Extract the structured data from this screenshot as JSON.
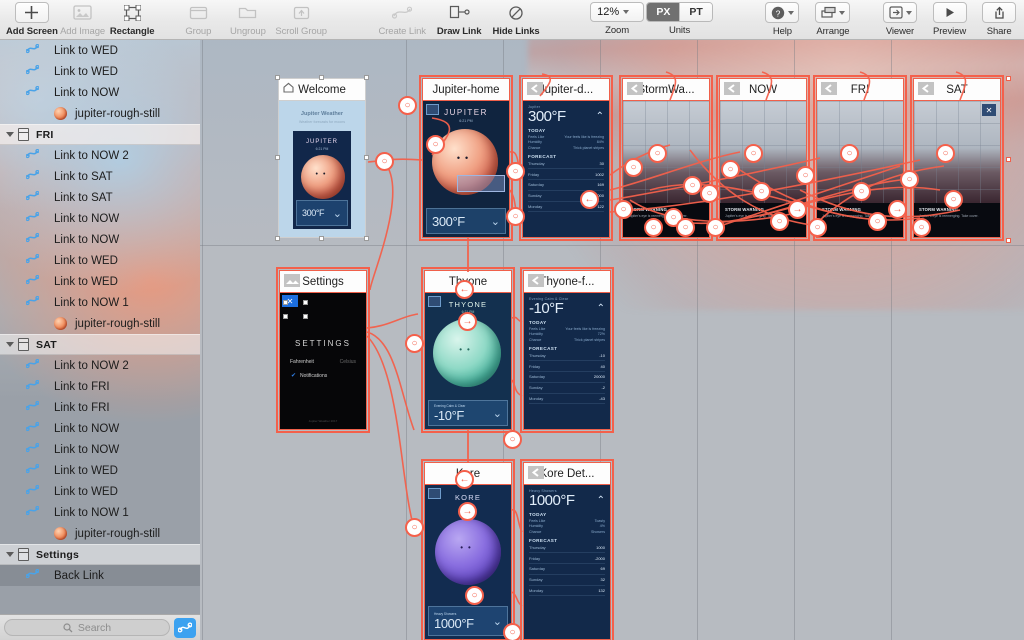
{
  "app": {
    "title": "Prototyping App Canvas"
  },
  "toolbar": {
    "items": [
      {
        "label": "Add Screen",
        "icon": "plus-icon",
        "enabled": true
      },
      {
        "label": "Add Image",
        "icon": "image-icon",
        "enabled": false
      },
      {
        "label": "Rectangle",
        "icon": "rectangle-icon",
        "enabled": true
      },
      {
        "label": "Group",
        "icon": "group-icon",
        "enabled": false
      },
      {
        "label": "Ungroup",
        "icon": "ungroup-icon",
        "enabled": false
      },
      {
        "label": "Scroll Group",
        "icon": "scroll-group-icon",
        "enabled": false
      },
      {
        "label": "Create Link",
        "icon": "create-link-icon",
        "enabled": false
      },
      {
        "label": "Draw Link",
        "icon": "draw-link-icon",
        "enabled": true
      },
      {
        "label": "Hide Links",
        "icon": "hide-links-icon",
        "enabled": true
      },
      {
        "label": "Help",
        "icon": "help-icon",
        "enabled": true
      },
      {
        "label": "Arrange",
        "icon": "arrange-icon",
        "enabled": true
      },
      {
        "label": "Viewer",
        "icon": "viewer-icon",
        "enabled": true
      },
      {
        "label": "Preview",
        "icon": "play-icon",
        "enabled": true
      },
      {
        "label": "Share",
        "icon": "share-icon",
        "enabled": true
      }
    ],
    "zoom": {
      "label": "Zoom",
      "value": "12%"
    },
    "units": {
      "label": "Units",
      "options": [
        "PX",
        "PT"
      ],
      "selected": "PX"
    }
  },
  "sidebar": {
    "search": {
      "placeholder": "Search",
      "icon": "search-icon"
    },
    "add_link_button": "add-link-icon",
    "sections": [
      {
        "name": "",
        "type": "items",
        "items": [
          {
            "label": "Link to WED",
            "icon": "link-icon",
            "selected": false
          },
          {
            "label": "Link to WED",
            "icon": "link-icon",
            "selected": false
          },
          {
            "label": "Link to NOW",
            "icon": "link-icon",
            "selected": false
          },
          {
            "label": "jupiter-rough-still",
            "icon": "jupiter-thumb",
            "selected": false
          }
        ]
      },
      {
        "name": "FRI",
        "type": "group",
        "icon": "screen-icon",
        "highlighted": true,
        "items": [
          {
            "label": "Link to NOW 2",
            "icon": "link-icon",
            "selected": false
          },
          {
            "label": "Link to SAT",
            "icon": "link-icon",
            "selected": false
          },
          {
            "label": "Link to SAT",
            "icon": "link-icon",
            "selected": false
          },
          {
            "label": "Link to NOW",
            "icon": "link-icon",
            "selected": false
          },
          {
            "label": "Link to NOW",
            "icon": "link-icon",
            "selected": false
          },
          {
            "label": "Link to WED",
            "icon": "link-icon",
            "selected": false
          },
          {
            "label": "Link to WED",
            "icon": "link-icon",
            "selected": false
          },
          {
            "label": "Link to NOW 1",
            "icon": "link-icon",
            "selected": false
          },
          {
            "label": "jupiter-rough-still",
            "icon": "jupiter-thumb",
            "selected": false
          }
        ]
      },
      {
        "name": "SAT",
        "type": "group",
        "icon": "screen-icon",
        "highlighted": false,
        "items": [
          {
            "label": "Link to NOW 2",
            "icon": "link-icon",
            "selected": false
          },
          {
            "label": "Link to FRI",
            "icon": "link-icon",
            "selected": false
          },
          {
            "label": "Link to FRI",
            "icon": "link-icon",
            "selected": false
          },
          {
            "label": "Link to NOW",
            "icon": "link-icon",
            "selected": false
          },
          {
            "label": "Link to NOW",
            "icon": "link-icon",
            "selected": false
          },
          {
            "label": "Link to WED",
            "icon": "link-icon",
            "selected": false
          },
          {
            "label": "Link to WED",
            "icon": "link-icon",
            "selected": false
          },
          {
            "label": "Link to NOW 1",
            "icon": "link-icon",
            "selected": false
          },
          {
            "label": "jupiter-rough-still",
            "icon": "jupiter-thumb",
            "selected": false
          }
        ]
      },
      {
        "name": "Settings",
        "type": "group",
        "icon": "screen-icon",
        "highlighted": false,
        "items": [
          {
            "label": "Back Link",
            "icon": "link-icon",
            "selected": true
          }
        ]
      }
    ]
  },
  "canvas": {
    "accent": "#f4604b",
    "background": "#b7bbc1",
    "screens": [
      {
        "id": "welcome",
        "title": "Welcome",
        "selected": false,
        "icon": "home-icon",
        "kind": "welcome"
      },
      {
        "id": "jupiter-home",
        "title": "Jupiter-home",
        "selected": true,
        "icon": "none",
        "kind": "planet-jupiter"
      },
      {
        "id": "jupiter-d",
        "title": "Jupiter-d...",
        "selected": true,
        "icon": "back-icon",
        "kind": "detail-jupiter"
      },
      {
        "id": "stormwa",
        "title": "StormWa...",
        "selected": true,
        "icon": "back-icon",
        "kind": "map-storm"
      },
      {
        "id": "now",
        "title": "NOW",
        "selected": true,
        "icon": "back-icon",
        "kind": "map-storm"
      },
      {
        "id": "fri",
        "title": "FRI",
        "selected": true,
        "icon": "back-icon",
        "kind": "map-storm"
      },
      {
        "id": "sat",
        "title": "SAT",
        "selected": true,
        "icon": "back-icon",
        "kind": "map-storm"
      },
      {
        "id": "settings",
        "title": "Settings",
        "selected": true,
        "icon": "screen-icon",
        "kind": "settings"
      },
      {
        "id": "thyone",
        "title": "Thyone",
        "selected": true,
        "icon": "none",
        "kind": "planet-thyone"
      },
      {
        "id": "thyone-f",
        "title": "Thyone-f...",
        "selected": true,
        "icon": "back-icon",
        "kind": "detail-thyone"
      },
      {
        "id": "kore",
        "title": "Kore",
        "selected": true,
        "icon": "none",
        "kind": "planet-kore"
      },
      {
        "id": "kore-det",
        "title": "Kore Det...",
        "selected": true,
        "icon": "back-icon",
        "kind": "detail-kore"
      }
    ]
  },
  "screen_content": {
    "welcome": {
      "app_name": "Jupiter Weather",
      "subtitle": "Weather forecasts for moons",
      "planet": "JUPITER",
      "planet_sub": "6:21 PM",
      "temp": "300°F"
    },
    "jupiter_home": {
      "planet": "JUPITER",
      "planet_sub": "6:21 PM",
      "temp": "300°F"
    },
    "jupiter_detail": {
      "caption": "Jupiter",
      "temp": "300°F",
      "today_label": "TODAY",
      "today_rows": [
        {
          "k": "Feels Like",
          "v": "Your feels like is freezing"
        },
        {
          "k": "Humidity",
          "v": "84%"
        },
        {
          "k": "Chance",
          "v": "Thick planet stripes"
        }
      ],
      "forecast_label": "FORECAST",
      "forecast": [
        {
          "day": "Thursday",
          "value": "30"
        },
        {
          "day": "Friday",
          "value": "1002"
        },
        {
          "day": "Saturday",
          "value": "169"
        },
        {
          "day": "Sunday",
          "value": "2000"
        },
        {
          "day": "Monday",
          "value": "122"
        }
      ]
    },
    "storm": {
      "heading": "STORM WARNING",
      "body": "Jupiter's eye is reemerging. Take cover."
    },
    "settings": {
      "title": "SETTINGS",
      "rows": [
        {
          "label": "Fahrenheit",
          "value": "Celsius"
        },
        {
          "label": "Notifications",
          "value": ""
        }
      ],
      "footer": "Jupiter Weather 2017"
    },
    "thyone": {
      "planet": "THYONE",
      "planet_sub": "6:21 PM",
      "caption": "Evening Calm & Clear",
      "temp": "-10°F"
    },
    "thyone_detail": {
      "caption": "Evening Calm & Clear",
      "temp": "-10°F",
      "today_label": "TODAY",
      "today_rows": [
        {
          "k": "Feels Like",
          "v": "Your feels like is freezing"
        },
        {
          "k": "Humidity",
          "v": "72%"
        },
        {
          "k": "Chance",
          "v": "Thick planet stripes"
        }
      ],
      "forecast_label": "FORECAST",
      "forecast": [
        {
          "day": "Thursday",
          "value": "-10"
        },
        {
          "day": "Friday",
          "value": "40"
        },
        {
          "day": "Saturday",
          "value": "20000"
        },
        {
          "day": "Sunday",
          "value": "-2"
        },
        {
          "day": "Monday",
          "value": "-43"
        }
      ]
    },
    "kore": {
      "planet": "KORE",
      "planet_sub": "6:21 PM",
      "caption": "Heavy Showers",
      "temp": "1000°F"
    },
    "kore_detail": {
      "caption": "Heavy Showers",
      "temp": "1000°F",
      "today_label": "TODAY",
      "today_rows": [
        {
          "k": "Feels Like",
          "v": "Toasty"
        },
        {
          "k": "Humidity",
          "v": "4%"
        },
        {
          "k": "Chance",
          "v": "Showers"
        }
      ],
      "forecast_label": "FORECAST",
      "forecast": [
        {
          "day": "Thursday",
          "value": "1000"
        },
        {
          "day": "Friday",
          "value": "-2000"
        },
        {
          "day": "Saturday",
          "value": "69"
        },
        {
          "day": "Sunday",
          "value": "32"
        },
        {
          "day": "Monday",
          "value": "132"
        }
      ]
    }
  }
}
